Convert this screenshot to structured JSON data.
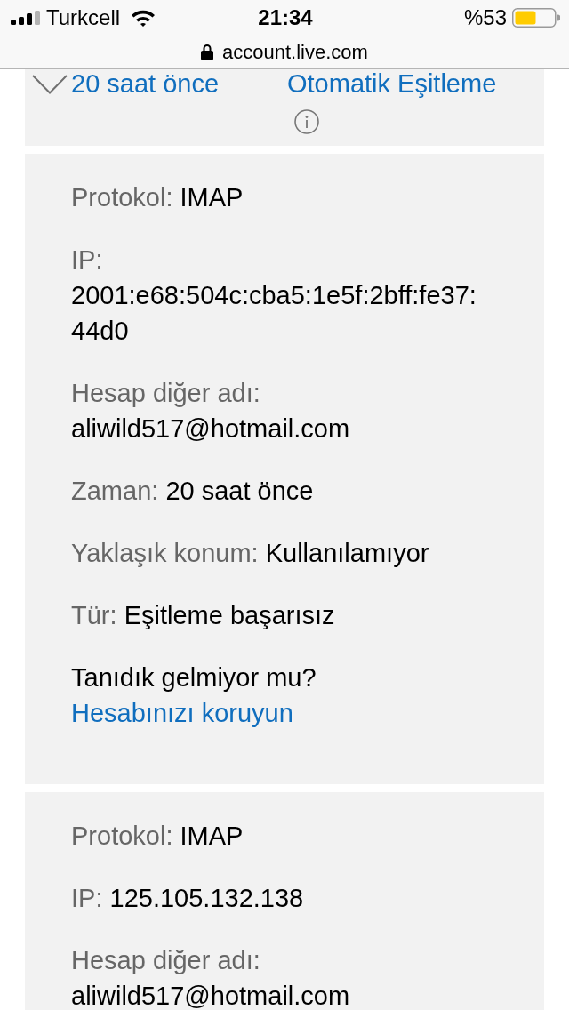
{
  "status_bar": {
    "carrier": "Turkcell",
    "time": "21:34",
    "battery": "%53"
  },
  "address_bar": {
    "url": "account.live.com"
  },
  "activity_summary": {
    "time": "20 saat önce",
    "type": "Otomatik Eşitleme"
  },
  "activity_details": [
    {
      "fields": [
        {
          "label": "Protokol:",
          "value": "IMAP"
        },
        {
          "label": "IP:",
          "value": "2001:e68:504c:cba5:1e5f:2bff:fe37:44d0"
        },
        {
          "label": "Hesap diğer adı:",
          "value": "aliwild517@hotmail.com"
        },
        {
          "label": "Zaman:",
          "value": "20 saat önce"
        },
        {
          "label": "Yaklaşık konum:",
          "value": "Kullanılamıyor"
        },
        {
          "label": "Tür:",
          "value": "Eşitleme başarısız"
        }
      ],
      "prompt": "Tanıdık gelmiyor mu?",
      "link": "Hesabınızı koruyun"
    },
    {
      "fields": [
        {
          "label": "Protokol:",
          "value": "IMAP"
        },
        {
          "label": "IP:",
          "value": "125.105.132.138"
        },
        {
          "label": "Hesap diğer adı:",
          "value": "aliwild517@hotmail.com"
        }
      ]
    }
  ]
}
